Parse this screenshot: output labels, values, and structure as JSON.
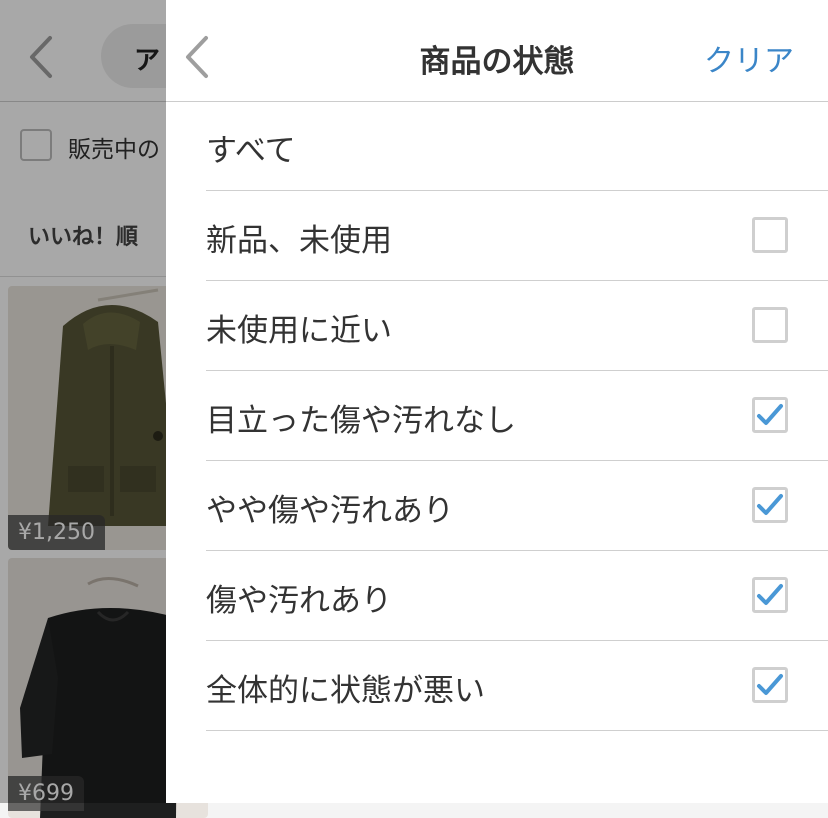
{
  "background": {
    "search_text": "ア",
    "filter_label": "販売中の",
    "sort_label": "いいね！順",
    "items": [
      {
        "price": "¥1,250"
      },
      {
        "price": "¥699"
      }
    ]
  },
  "drawer": {
    "title": "商品の状態",
    "clear_label": "クリア",
    "all_label": "すべて",
    "options": [
      {
        "label": "新品、未使用",
        "checked": false
      },
      {
        "label": "未使用に近い",
        "checked": false
      },
      {
        "label": "目立った傷や汚れなし",
        "checked": true
      },
      {
        "label": "やや傷や汚れあり",
        "checked": true
      },
      {
        "label": "傷や汚れあり",
        "checked": true
      },
      {
        "label": "全体的に状態が悪い",
        "checked": true
      }
    ]
  },
  "colors": {
    "accent": "#3b86c8",
    "check": "#4a98d6",
    "divider": "#cfcfcf"
  }
}
